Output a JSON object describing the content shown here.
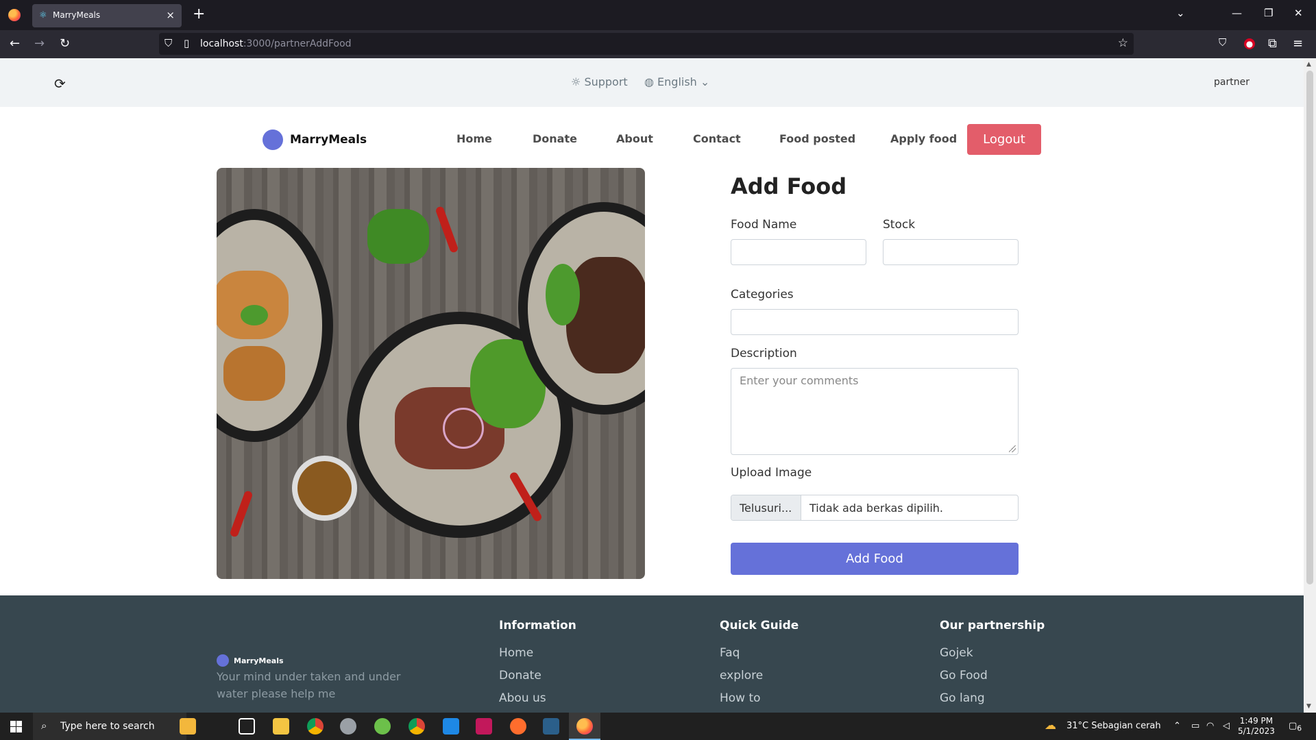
{
  "browser": {
    "tab_title": "MarryMeals",
    "url_host": "localhost",
    "url_rest": ":3000/partnerAddFood"
  },
  "topbar": {
    "support": "Support",
    "language": "English",
    "user": "partner"
  },
  "nav": {
    "brand": "MarryMeals",
    "links": [
      "Home",
      "Donate",
      "About",
      "Contact",
      "Food posted",
      "Apply food"
    ],
    "logout": "Logout"
  },
  "form": {
    "title": "Add Food",
    "food_name_label": "Food Name",
    "stock_label": "Stock",
    "categories_label": "Categories",
    "description_label": "Description",
    "description_placeholder": "Enter your comments",
    "upload_label": "Upload Image",
    "file_button": "Telusuri...",
    "file_status": "Tidak ada berkas dipilih.",
    "submit": "Add Food"
  },
  "footer": {
    "brand": "MarryMeals",
    "tagline": "Your mind under taken and under water please help me",
    "columns": [
      {
        "title": "Information",
        "links": [
          "Home",
          "Donate",
          "Abou us"
        ]
      },
      {
        "title": "Quick Guide",
        "links": [
          "Faq",
          "explore",
          "How to"
        ]
      },
      {
        "title": "Our partnership",
        "links": [
          "Gojek",
          "Go Food",
          "Go lang"
        ]
      }
    ]
  },
  "taskbar": {
    "search_placeholder": "Type here to search",
    "weather": "31°C  Sebagian cerah",
    "time": "1:49 PM",
    "date": "5/1/2023",
    "notifications": "6"
  },
  "colors": {
    "primary": "#6571d9",
    "logout": "#e35d6a",
    "footer": "#37474f",
    "topbar": "#f0f3f5"
  }
}
